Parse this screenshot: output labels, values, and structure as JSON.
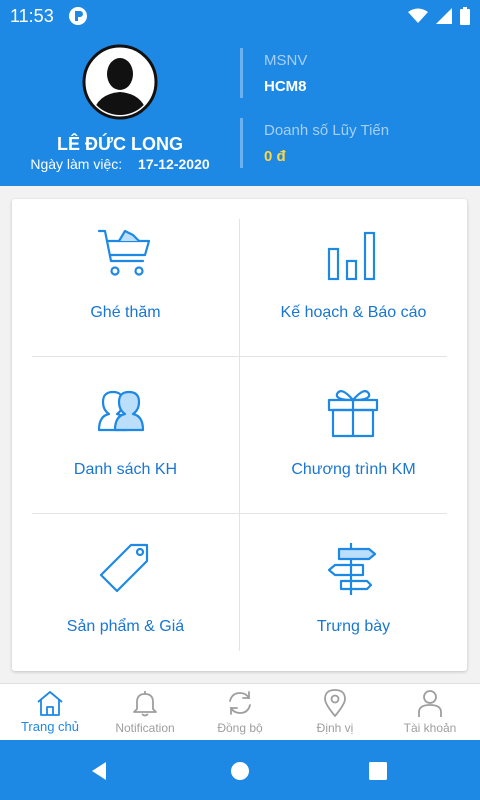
{
  "status_bar": {
    "time": "11:53"
  },
  "profile": {
    "name": "LÊ ĐỨC LONG",
    "work_date_label": "Ngày làm việc:",
    "work_date_value": "17-12-2020"
  },
  "info": {
    "employee_id_label": "MSNV",
    "employee_id_value": "HCM8",
    "sales_label": "Doanh số Lũy Tiến",
    "sales_value": "0 đ"
  },
  "menu": [
    {
      "label": "Ghé thăm",
      "icon": "shopping-basket-icon"
    },
    {
      "label": "Kế hoạch & Báo cáo",
      "icon": "bar-chart-icon"
    },
    {
      "label": "Danh sách KH",
      "icon": "customers-icon"
    },
    {
      "label": "Chương trình KM",
      "icon": "gift-icon"
    },
    {
      "label": "Sản phẩm & Giá",
      "icon": "price-tag-icon"
    },
    {
      "label": "Trưng bày",
      "icon": "signpost-icon"
    }
  ],
  "bottom_nav": [
    {
      "label": "Trang chủ",
      "icon": "home-icon",
      "active": true
    },
    {
      "label": "Notification",
      "icon": "bell-icon"
    },
    {
      "label": "Đồng bộ",
      "icon": "sync-icon"
    },
    {
      "label": "Định vị",
      "icon": "location-pin-icon"
    },
    {
      "label": "Tài khoản",
      "icon": "account-icon"
    }
  ],
  "colors": {
    "primary": "#1e88e5",
    "accent_text": "#1976d2",
    "sales_value": "#ffd740",
    "divider": "#e3e3e3"
  }
}
